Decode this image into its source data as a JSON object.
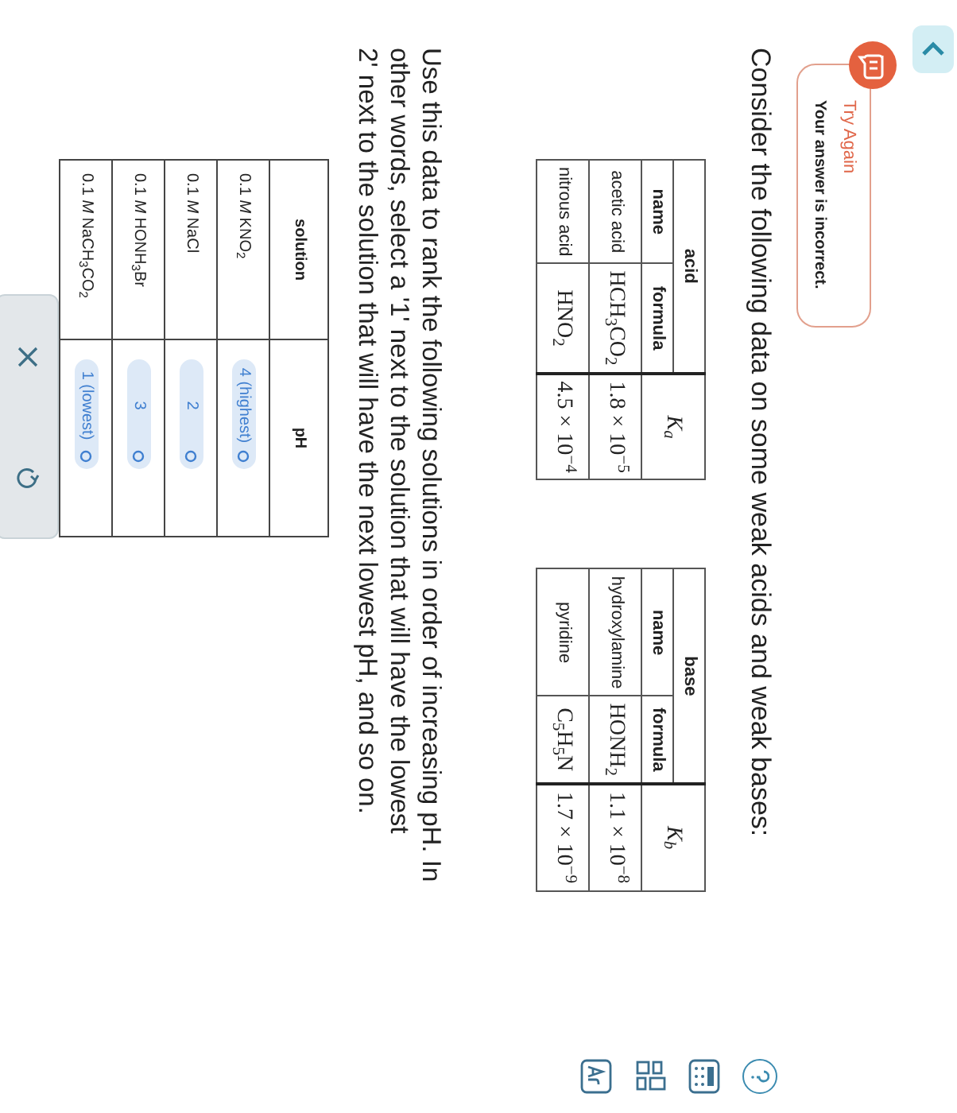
{
  "feedback": {
    "title": "Try Again",
    "message": "Your answer is incorrect."
  },
  "question": "Consider the following data on some weak acids and weak bases:",
  "acid_table": {
    "group_heading": "acid",
    "name_heading": "name",
    "formula_heading": "formula",
    "constant_heading": "K$_{a}$",
    "entries": [
      {
        "name": "acetic acid",
        "formula": "HCH$_{3}$CO$_{2}$",
        "constant": "1.8 × 10$^{−5}$"
      },
      {
        "name": "nitrous acid",
        "formula": "HNO$_{2}$",
        "constant": "4.5 × 10$^{−4}$"
      }
    ]
  },
  "base_table": {
    "group_heading": "base",
    "name_heading": "name",
    "formula_heading": "formula",
    "constant_heading": "K$_{b}$",
    "entries": [
      {
        "name": "hydroxylamine",
        "formula": "HONH$_{2}$",
        "constant": "1.1 × 10$^{−8}$"
      },
      {
        "name": "pyridine",
        "formula": "C$_{5}$H$_{5}$N",
        "constant": "1.7 × 10$^{−9}$"
      }
    ]
  },
  "instructions": [
    "Use this data to rank the following solutions in order of increasing pH. In",
    "other words, select a '1' next to the solution that will have the lowest",
    "2' next to the solution that will have the next lowest pH, and so on."
  ],
  "solution_table": {
    "columns": [
      "solution",
      "pH"
    ],
    "rows": [
      {
        "solution": "0.1 *M* KNO$_{2}$",
        "rank": "4 (highest)"
      },
      {
        "solution": "0.1 *M* NaCl",
        "rank": "2"
      },
      {
        "solution": "0.1 *M* HONH$_{3}$Br",
        "rank": "3"
      },
      {
        "solution": "0.1 *M* NaCH$_{3}$CO$_{2}$",
        "rank": "1 (lowest)"
      }
    ]
  }
}
